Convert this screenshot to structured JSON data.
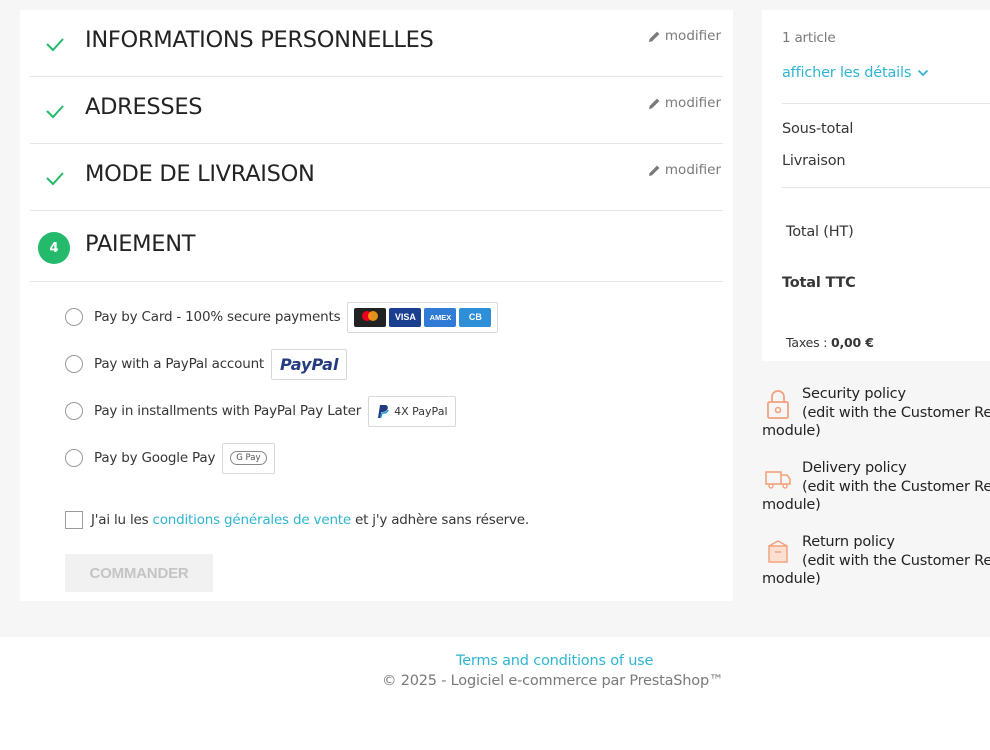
{
  "steps": [
    {
      "title": "INFORMATIONS PERSONNELLES",
      "edit_label": "modifier",
      "status": "complete"
    },
    {
      "title": "ADRESSES",
      "edit_label": "modifier",
      "status": "complete"
    },
    {
      "title": "MODE DE LIVRAISON",
      "edit_label": "modifier",
      "status": "complete"
    },
    {
      "title": "PAIEMENT",
      "number": "4",
      "status": "current"
    }
  ],
  "payment_options": [
    {
      "label": "Pay by Card - 100% secure payments",
      "cards": [
        "mastercard",
        "VISA",
        "AMEX",
        "CB"
      ]
    },
    {
      "label": "Pay with a PayPal account",
      "logo": "PayPal"
    },
    {
      "label": "Pay in installments with PayPal Pay Later",
      "logo": "4X PayPal"
    },
    {
      "label": "Pay by Google Pay",
      "logo": "G Pay"
    }
  ],
  "terms": {
    "prefix": "J'ai lu les",
    "link": "conditions générales de vente",
    "suffix": "et j'y adhère sans réserve."
  },
  "order_button": "COMMANDER",
  "summary": {
    "items_count": "1 article",
    "show_details": "afficher les détails",
    "subtotal_label": "Sous-total",
    "shipping_label": "Livraison",
    "total_ht_label": "Total (HT)",
    "total_ttc_label": "Total TTC",
    "taxes_label": "Taxes :",
    "taxes_value": "0,00 €"
  },
  "policies": [
    {
      "title": "Security policy",
      "desc": "(edit with the Customer Re",
      "desc2": "module)",
      "icon": "lock-icon"
    },
    {
      "title": "Delivery policy",
      "desc": "(edit with the Customer Re",
      "desc2": "module)",
      "icon": "truck-icon"
    },
    {
      "title": "Return policy",
      "desc": "(edit with the Customer Re",
      "desc2": "module)",
      "icon": "box-icon"
    }
  ],
  "footer": {
    "link": "Terms and conditions of use",
    "copyright": "© 2025 - Logiciel e-commerce par PrestaShop™"
  },
  "colors": {
    "accent_green": "#24b96b",
    "link_blue": "#2fb5d2"
  }
}
